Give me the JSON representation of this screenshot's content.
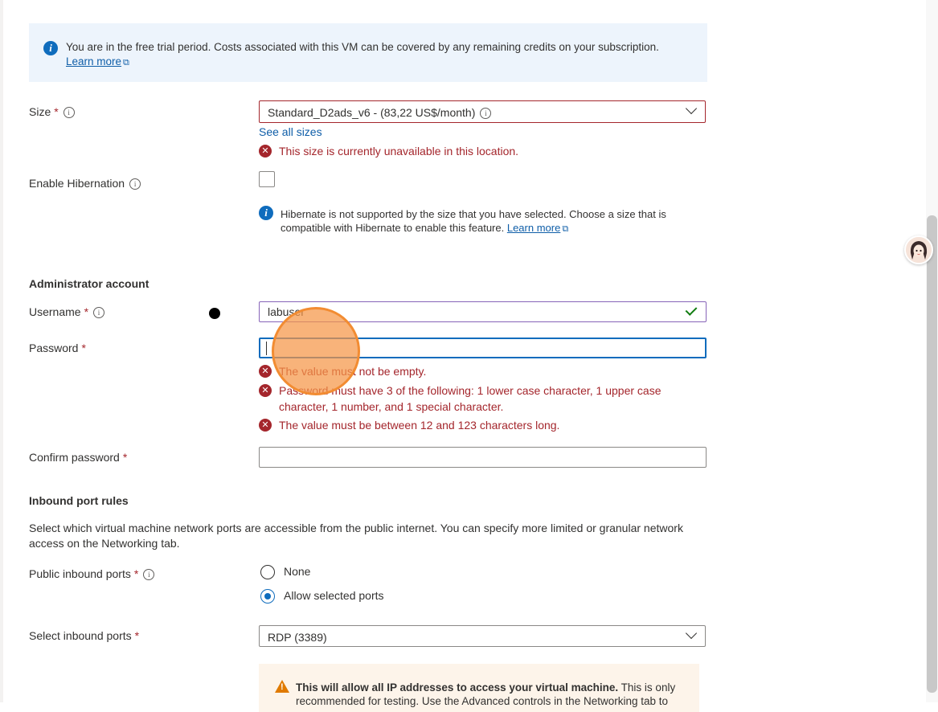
{
  "banner": {
    "text": "You are in the free trial period. Costs associated with this VM can be covered by any remaining credits on your subscription.",
    "link": "Learn more"
  },
  "size": {
    "label": "Size",
    "value": "Standard_D2ads_v6 - (83,22 US$/month)",
    "see_all": "See all sizes",
    "error": "This size is currently unavailable in this location."
  },
  "hibernation": {
    "label": "Enable Hibernation",
    "checked": false,
    "note": "Hibernate is not supported by the size that you have selected. Choose a size that is compatible with Hibernate to enable this feature.",
    "note_link": "Learn more"
  },
  "admin": {
    "title": "Administrator account",
    "username_label": "Username",
    "username_value": "labuser",
    "password_label": "Password",
    "password_value": "",
    "password_errors": [
      "The value must not be empty.",
      "Password must have 3 of the following: 1 lower case character, 1 upper case character, 1 number, and 1 special character.",
      "The value must be between 12 and 123 characters long."
    ],
    "confirm_label": "Confirm password",
    "confirm_value": ""
  },
  "inbound": {
    "title": "Inbound port rules",
    "description": "Select which virtual machine network ports are accessible from the public internet. You can specify more limited or granular network access on the Networking tab.",
    "public_label": "Public inbound ports",
    "options": [
      "None",
      "Allow selected ports"
    ],
    "selected_option": "Allow selected ports",
    "select_label": "Select inbound ports",
    "select_value": "RDP (3389)",
    "warning_bold": "This will allow all IP addresses to access your virtual machine.",
    "warning_rest": " This is only recommended for testing. Use the Advanced controls in the Networking tab to"
  },
  "required_marker": "*",
  "colors": {
    "error": "#a4262c",
    "link": "#0f5ea8",
    "accent": "#0f6cbd",
    "banner_bg": "#edf4fc",
    "warning_bg": "#fdf4ea"
  }
}
